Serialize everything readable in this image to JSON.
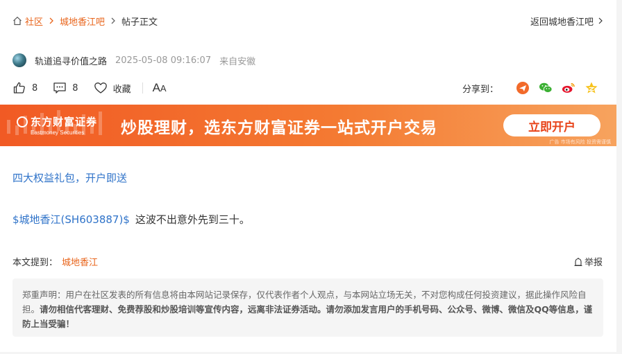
{
  "breadcrumb": {
    "home": "社区",
    "forum": "城地香江吧",
    "current": "帖子正文",
    "back": "返回城地香江吧"
  },
  "author": {
    "name": "轨道追寻价值之路",
    "time": "2025-05-08 09:16:07",
    "from": "来自安徽"
  },
  "actions": {
    "likes": "8",
    "comments": "8",
    "favorite": "收藏",
    "font_big": "A",
    "font_small": "A"
  },
  "share": {
    "label": "分享到："
  },
  "banner": {
    "brand_cn": "东方财富证券",
    "brand_en": "Eastmoney Securities",
    "slogan": "炒股理财，选东方财富证券一站式开户交易",
    "cta": "立即开户",
    "ad_note": "广告 市场有风险 投资需谨慎"
  },
  "post": {
    "promo": "四大权益礼包，开户即送",
    "stock_tag": "$城地香江(SH603887)$",
    "text": "这波不出意外先到三十。"
  },
  "mention": {
    "label": "本文提到：",
    "tag": "城地香江"
  },
  "report": "举报",
  "disclaimer": {
    "normal": "郑重声明：用户在社区发表的所有信息将由本网站记录保存，仅代表作者个人观点，与本网站立场无关，不对您构成任何投资建议，据此操作风险自担。",
    "bold": "请勿相信代客理财、免费荐股和炒股培训等宣传内容，远离非法证券活动。请勿添加发言用户的手机号码、公众号、微博、微信及QQ等信息，谨防上当受骗！"
  },
  "colors": {
    "accent": "#e8641b",
    "link": "#2f73c9",
    "banner_start": "#f15a24",
    "banner_end": "#f7a35e"
  }
}
